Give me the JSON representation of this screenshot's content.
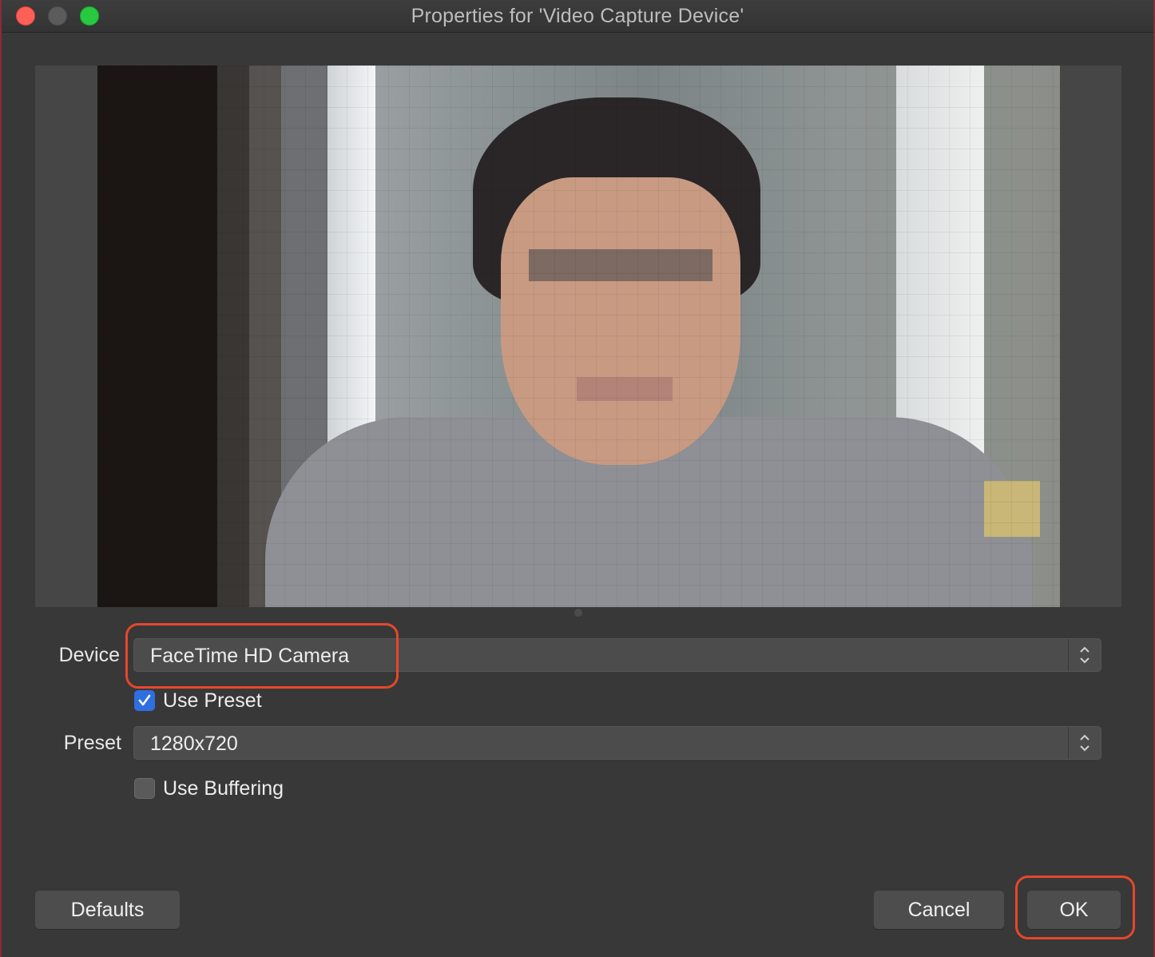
{
  "window": {
    "title": "Properties for 'Video Capture Device'"
  },
  "form": {
    "device_label": "Device",
    "device_value": "FaceTime HD Camera",
    "use_preset_label": "Use Preset",
    "use_preset_checked": true,
    "preset_label": "Preset",
    "preset_value": "1280x720",
    "use_buffering_label": "Use Buffering",
    "use_buffering_checked": false
  },
  "buttons": {
    "defaults": "Defaults",
    "cancel": "Cancel",
    "ok": "OK"
  },
  "colors": {
    "background": "#383838",
    "control": "#4c4c4c",
    "checkbox_accent": "#2f6fe0",
    "highlight": "#e6472b"
  }
}
